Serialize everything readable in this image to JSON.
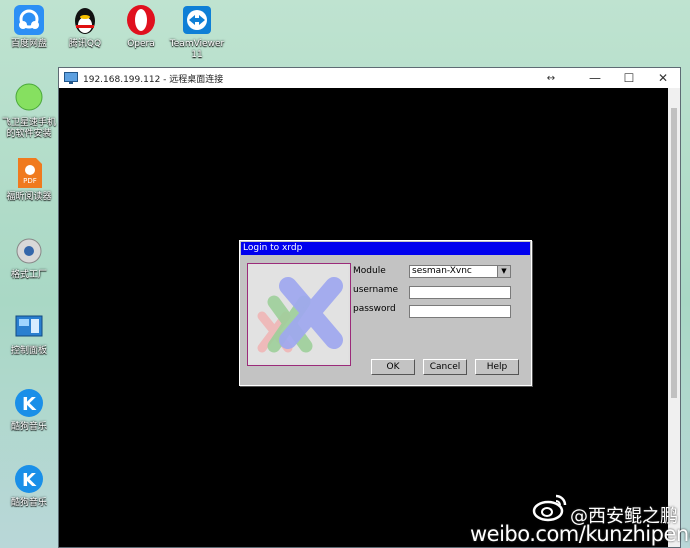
{
  "desktop": {
    "icons": [
      {
        "label": "百度网盘",
        "icon": "baidu-cloud-icon"
      },
      {
        "label": "腾讯QQ",
        "icon": "qq-penguin-icon"
      },
      {
        "label": "Opera",
        "icon": "opera-icon"
      },
      {
        "label": "TeamViewer 11",
        "icon": "teamviewer-icon"
      },
      {
        "label": "飞卫星速手机的软件安装",
        "icon": "green-circle-icon"
      },
      {
        "label": "福昕阅读器",
        "icon": "pdf-reader-icon"
      },
      {
        "label": "格式工厂",
        "icon": "format-factory-icon"
      },
      {
        "label": "控制面板",
        "icon": "control-panel-icon"
      },
      {
        "label": "酷狗音乐",
        "icon": "kugou-icon"
      },
      {
        "label": "酷狗音乐",
        "icon": "kugou-icon"
      }
    ]
  },
  "rdp_window": {
    "title": "192.168.199.112 - 远程桌面连接",
    "resize_glyph": "↔",
    "minimize_glyph": "—",
    "maximize_glyph": "☐",
    "close_glyph": "✕"
  },
  "xrdp": {
    "title": "Login to xrdp",
    "module_label": "Module",
    "module_value": "sesman-Xvnc",
    "username_label": "username",
    "username_value": "",
    "password_label": "password",
    "password_value": "",
    "ok_label": "OK",
    "cancel_label": "Cancel",
    "help_label": "Help"
  },
  "watermark": {
    "handle": "@西安鲲之鹏",
    "url": "weibo.com/kunzhipeng"
  },
  "colors": {
    "xrdp_title": "#0000ee",
    "dialog_gray": "#c3c3c3",
    "desktop": "#b7dcc9"
  }
}
